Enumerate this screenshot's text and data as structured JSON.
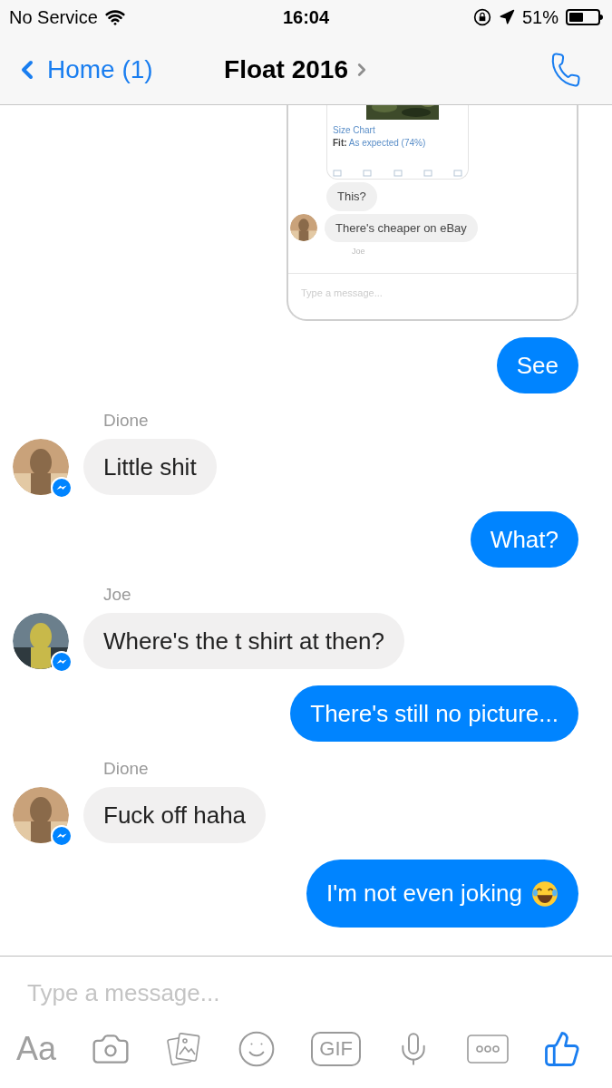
{
  "status_bar": {
    "carrier": "No Service",
    "time": "16:04",
    "battery": "51%"
  },
  "nav": {
    "back": "Home (1)",
    "title": "Float 2016"
  },
  "messages": [
    {
      "kind": "screenshot",
      "size_chart": "Size Chart",
      "fit_label": "Fit:",
      "fit_value": "As expected (74%)",
      "bubbles": [
        "This?",
        "There's cheaper on eBay"
      ],
      "sender": "Joe",
      "placeholder": "Type a message..."
    },
    {
      "kind": "sent",
      "text": "See"
    },
    {
      "kind": "received",
      "sender": "Dione",
      "text": "Little shit"
    },
    {
      "kind": "sent",
      "text": "What?"
    },
    {
      "kind": "received",
      "sender": "Joe",
      "text": "Where's the t shirt at then?"
    },
    {
      "kind": "sent",
      "text": "There's still no picture..."
    },
    {
      "kind": "received",
      "sender": "Dione",
      "text": "Fuck off haha"
    },
    {
      "kind": "sent",
      "text": "I'm not even joking",
      "emoji": true
    }
  ],
  "composer": {
    "placeholder": "Type a message...",
    "text_button": "Aa",
    "gif_button": "GIF"
  }
}
